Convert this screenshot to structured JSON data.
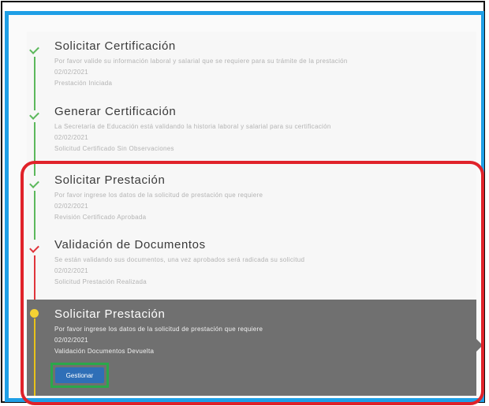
{
  "steps": [
    {
      "title": "Solicitar Certificación",
      "description": "Por favor valide su información laboral y salarial que se requiere para su trámite de la prestación",
      "date": "02/02/2021",
      "status": "Prestación Iniciada",
      "state": "done"
    },
    {
      "title": "Generar Certificación",
      "description": "La Secretaría de Educación está validando la historia laboral y salarial para su certificación",
      "date": "02/02/2021",
      "status": "Solicitud Certificado Sin Observaciones",
      "state": "done"
    },
    {
      "title": "Solicitar Prestación",
      "description": "Por favor ingrese los datos de la solicitud de prestación que requiere",
      "date": "02/02/2021",
      "status": "Revisión Certificado Aprobada",
      "state": "done"
    },
    {
      "title": "Validación de Documentos",
      "description": "Se están validando sus documentos, una vez aprobados será radicada su solicitud",
      "date": "02/02/2021",
      "status": "Solicitud Prestación Realizada",
      "state": "rejected"
    }
  ],
  "active_step": {
    "title": "Solicitar Prestación",
    "description": "Por favor ingrese los datos de la solicitud de prestación que requiere",
    "date": "02/02/2021",
    "status": "Validación Documentos Devuelta",
    "button_label": "Gestionar"
  },
  "colors": {
    "done": "#5cb85c",
    "rejected": "#e0353b",
    "active_dot": "#f5d233",
    "active_bg": "#707070",
    "button": "#2f6fb7",
    "highlight_red": "#e0222a",
    "highlight_green": "#2aa84a",
    "frame_blue": "#1e9fe6"
  }
}
